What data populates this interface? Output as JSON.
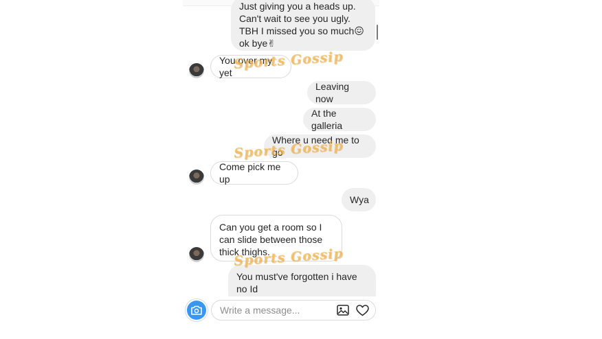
{
  "messages": [
    {
      "dir": "out",
      "text": "Just giving you a heads up. Can't wait to see you ugly. TBH I missed you so much😖 ok bye✌"
    },
    {
      "dir": "in",
      "text": "You over my yet"
    },
    {
      "dir": "out",
      "text": "Leaving now"
    },
    {
      "dir": "out",
      "text": "At the galleria"
    },
    {
      "dir": "out",
      "text": "Where u need me to go"
    },
    {
      "dir": "in",
      "text": "Come pick me up"
    },
    {
      "dir": "out",
      "text": "Wya"
    },
    {
      "dir": "in",
      "text": "Can you get a room so I can slide between those thick thighs."
    },
    {
      "dir": "out",
      "text": "You must've forgotten i have no Id"
    }
  ],
  "watermark": "Sports Gossip",
  "composer": {
    "placeholder": "Write a message..."
  },
  "colors": {
    "accent": "#3897f0",
    "outgoing_bubble": "#efefef",
    "incoming_border": "#dbdbdb",
    "watermark": "#f2b752"
  },
  "icons": {
    "camera": "camera-icon",
    "gallery": "image-icon",
    "like": "heart-icon"
  }
}
